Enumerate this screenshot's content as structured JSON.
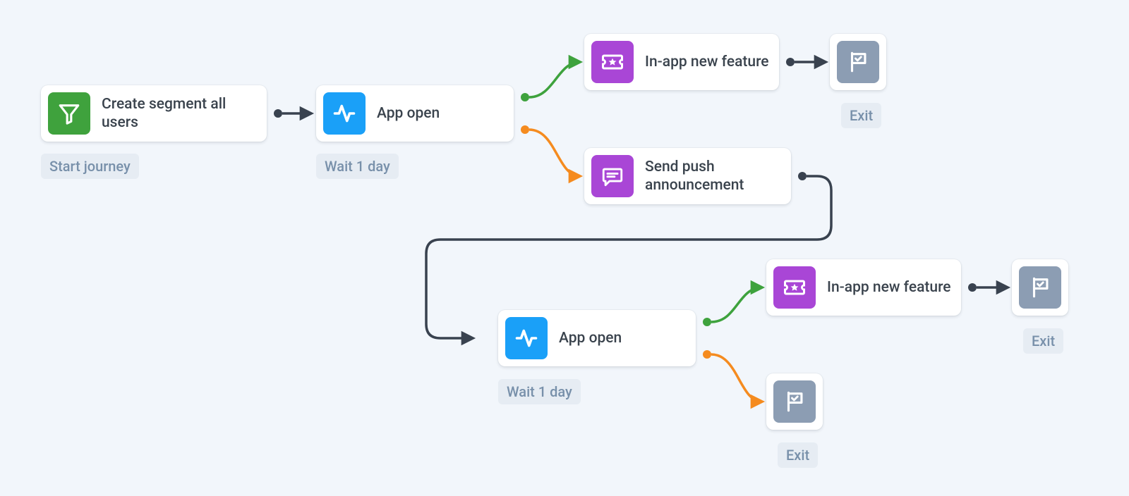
{
  "nodes": {
    "segment": {
      "label": "Create segment all users"
    },
    "appopen1": {
      "label": "App open"
    },
    "inapp1": {
      "label": "In-app new feature"
    },
    "push": {
      "label": "Send push announcement"
    },
    "appopen2": {
      "label": "App open"
    },
    "inapp2": {
      "label": "In-app new feature"
    }
  },
  "captions": {
    "start": "Start journey",
    "wait1": "Wait 1 day",
    "wait2": "Wait 1 day",
    "exit1": "Exit",
    "exit2": "Exit",
    "exit3": "Exit"
  },
  "colors": {
    "green": "#3fa23d",
    "blue": "#1aa0f8",
    "purple": "#a946d6",
    "slate": "#8c9db3",
    "edge_dark": "#39424f",
    "edge_green": "#3ea23d",
    "edge_orange": "#f58b1f"
  }
}
